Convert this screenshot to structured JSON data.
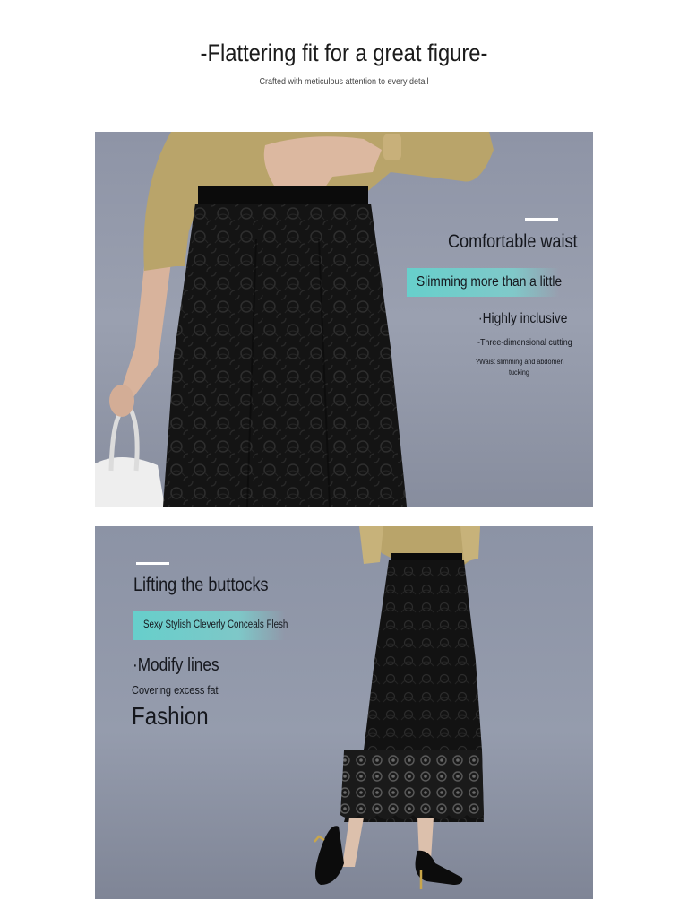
{
  "header": {
    "title": "-Flattering fit for a great figure-",
    "subtitle": "Crafted with meticulous attention to every detail"
  },
  "panel1": {
    "heading": "Comfortable waist",
    "highlight": "Slimming more than a little",
    "point": "·Highly inclusive",
    "detail1": "-Three-dimensional cutting",
    "detail2_line1": "?Waist slimming and abdomen",
    "detail2_line2": "tucking"
  },
  "panel2": {
    "heading": "Lifting the buttocks",
    "highlight": "Sexy Stylish Cleverly Conceals Flesh",
    "point": "·Modify lines",
    "detail": "Covering excess fat",
    "big": "Fashion"
  },
  "colors": {
    "background": "#ffffff",
    "panel": "#9aa0b0",
    "teal_highlight": "#64d2cd",
    "skirt": "#111111",
    "top": "#b9a46a"
  }
}
